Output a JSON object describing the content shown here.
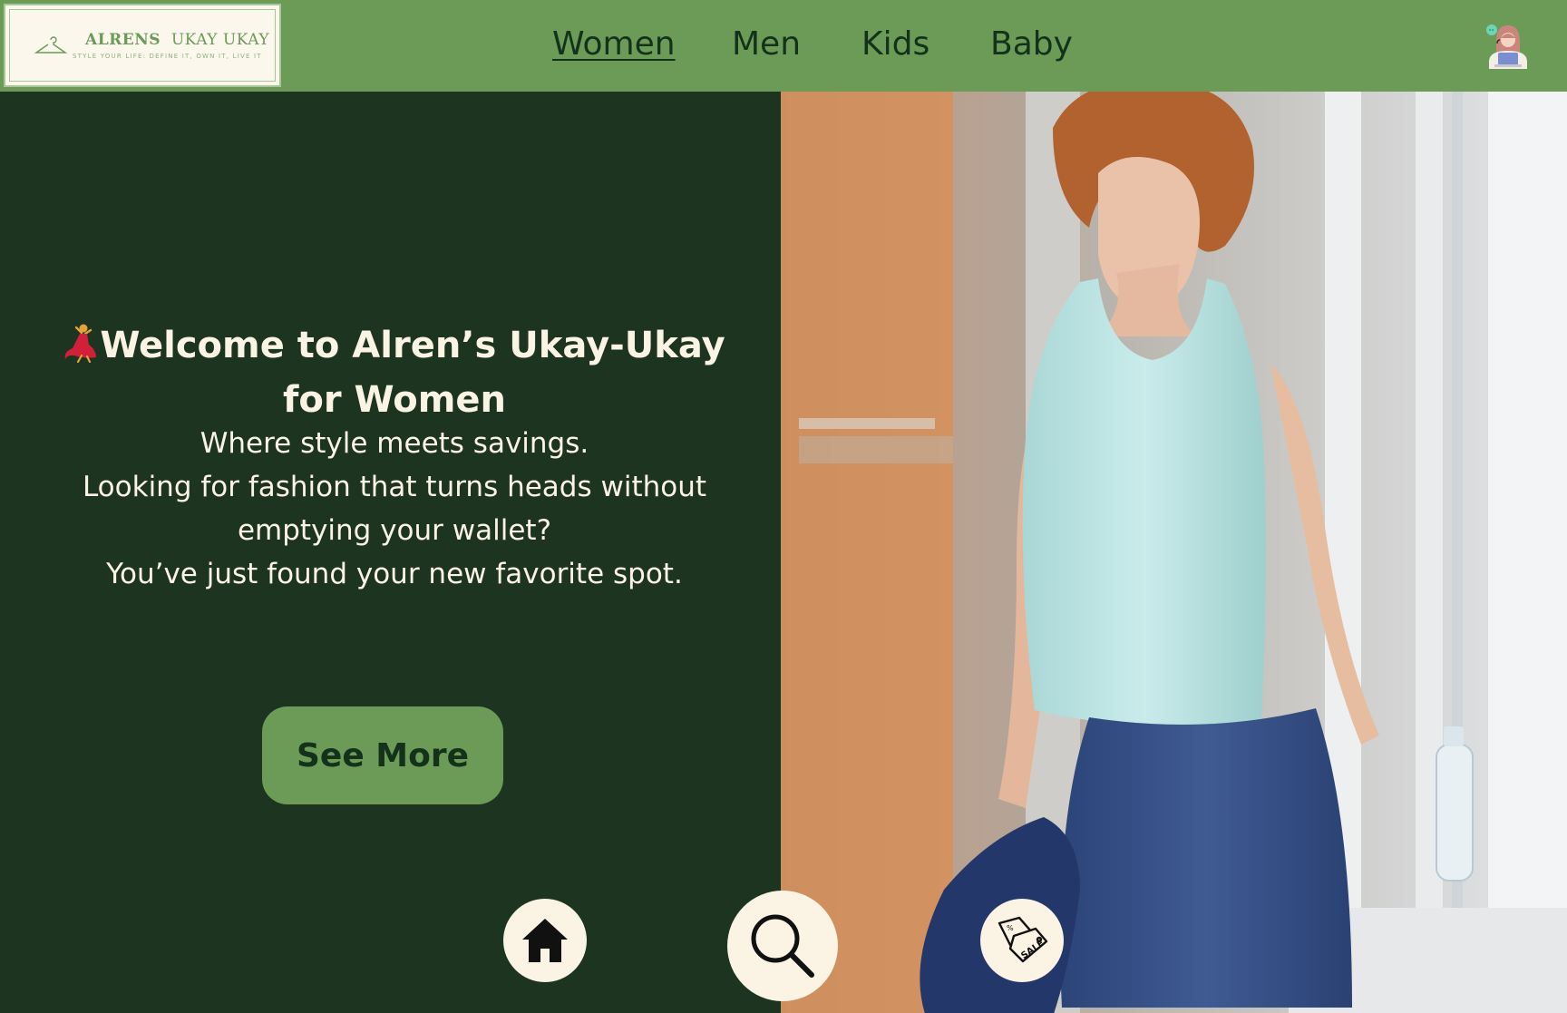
{
  "header": {
    "logo": {
      "brand_bold": "ALRENS",
      "brand_light": "UKAY UKAY",
      "tagline": "STYLE YOUR LIFE: DEFINE IT, OWN IT, LIVE IT",
      "icon": "hanger-icon"
    },
    "nav": [
      {
        "label": "Women",
        "active": true
      },
      {
        "label": "Men",
        "active": false
      },
      {
        "label": "Kids",
        "active": false
      },
      {
        "label": "Baby",
        "active": false
      }
    ],
    "avatar_icon": "support-agent-icon"
  },
  "hero": {
    "heading": "Welcome to Alren’s Ukay-Ukay for Women",
    "heading_emoji_icon": "dancer-icon",
    "lines": [
      "Where style meets savings.",
      "Looking for fashion that turns heads without",
      "emptying your wallet?",
      "You’ve just found your new favorite spot."
    ],
    "cta_label": "See More"
  },
  "bottom_icons": [
    "home-icon",
    "search-icon",
    "sale-tag-icon"
  ],
  "colors": {
    "header_bg": "#6b9b57",
    "panel_bg": "#1c3420",
    "text_light": "#fbf3e4",
    "text_dark": "#14321b"
  }
}
